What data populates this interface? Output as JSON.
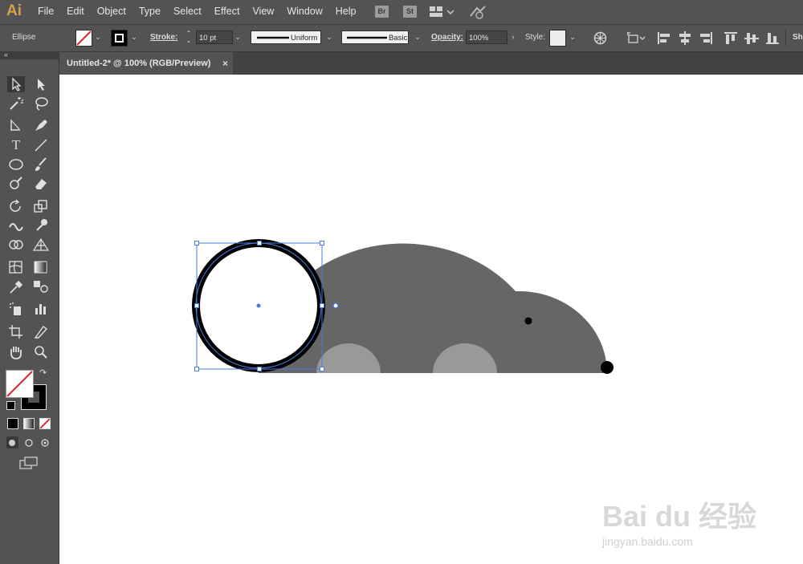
{
  "app": {
    "logo": "Ai"
  },
  "menu": [
    "File",
    "Edit",
    "Object",
    "Type",
    "Select",
    "Effect",
    "View",
    "Window",
    "Help"
  ],
  "menu_icons": {
    "bridge": "Br",
    "stock": "St"
  },
  "options": {
    "selection_type": "Ellipse",
    "stroke_label": "Stroke:",
    "stroke_weight": "10 pt",
    "profile_uniform": "Uniform",
    "brush_basic": "Basic",
    "opacity_label": "Opacity:",
    "opacity_value": "100%",
    "style_label": "Style:",
    "overflow_label": "Sh"
  },
  "document": {
    "tab_title": "Untitled-2* @ 100% (RGB/Preview)",
    "close_glyph": "×"
  },
  "watermark": {
    "brand": "Bai du 经验",
    "url": "jingyan.baidu.com"
  },
  "colors": {
    "shape_gray": "#666666",
    "wheel_gray": "#999999",
    "selection_blue": "#4a7bdc",
    "logo_orange": "#d7a14c"
  }
}
